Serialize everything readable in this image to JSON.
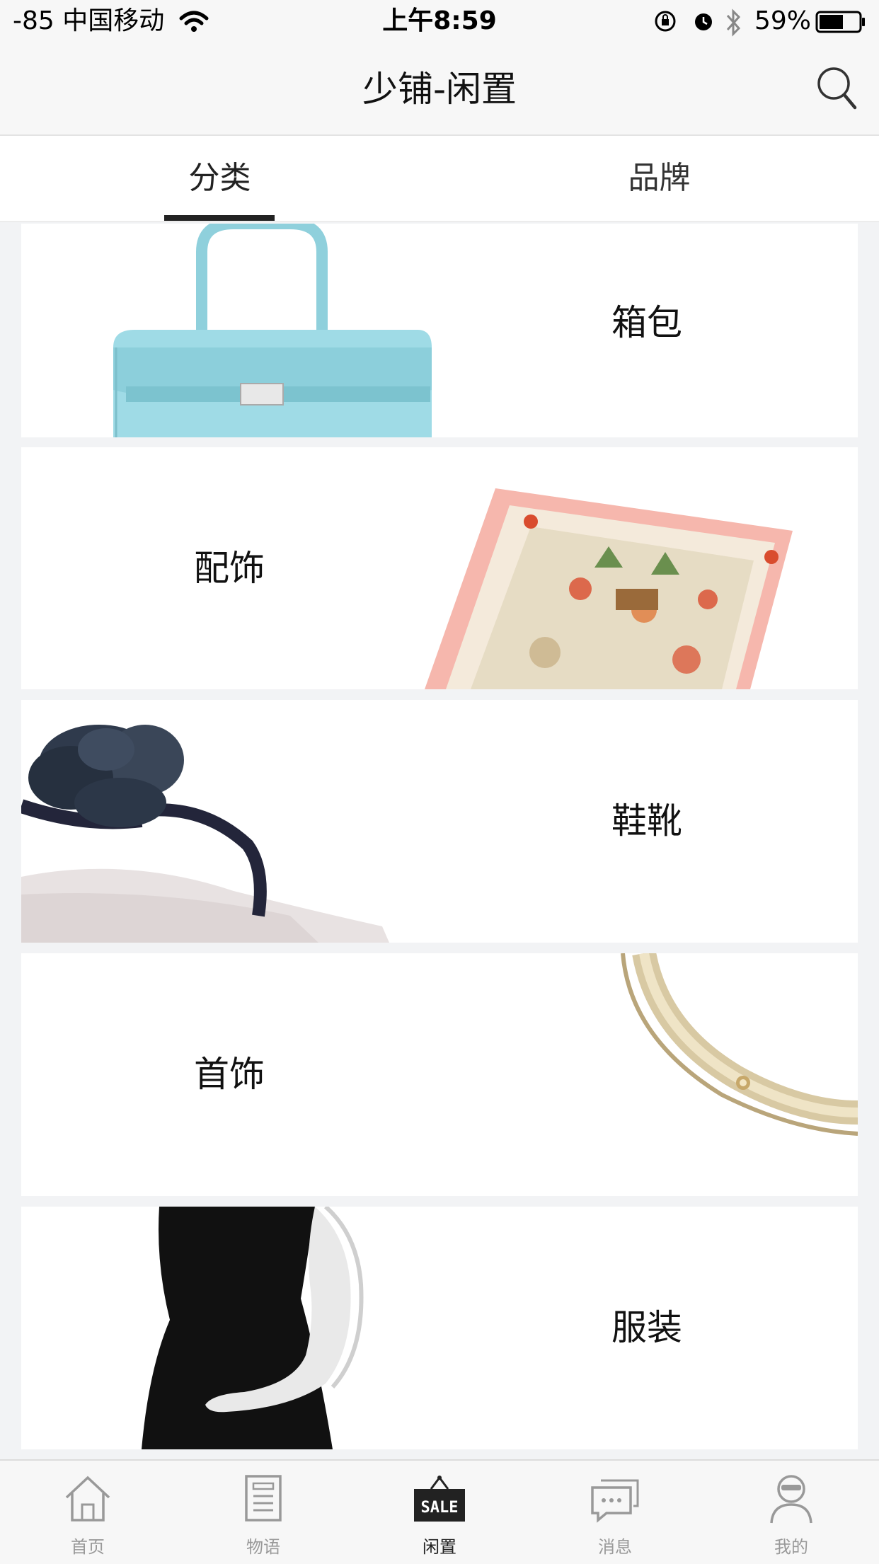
{
  "status_bar": {
    "carrier": "-85 中国移动",
    "time": "上午8:59",
    "battery": "59%"
  },
  "nav": {
    "title": "少铺-闲置"
  },
  "tabs": [
    {
      "label": "分类",
      "active": true
    },
    {
      "label": "品牌",
      "active": false
    }
  ],
  "categories": [
    {
      "label": "箱包",
      "image": "handbag"
    },
    {
      "label": "配饰",
      "image": "silk-scarf"
    },
    {
      "label": "鞋靴",
      "image": "sandal"
    },
    {
      "label": "首饰",
      "image": "ring"
    },
    {
      "label": "服装",
      "image": "dress"
    }
  ],
  "bottom_tabs": [
    {
      "label": "首页",
      "icon": "home-icon"
    },
    {
      "label": "物语",
      "icon": "document-icon"
    },
    {
      "label": "闲置",
      "icon": "sale-icon",
      "active": true,
      "badge_text": "SALE"
    },
    {
      "label": "消息",
      "icon": "message-icon"
    },
    {
      "label": "我的",
      "icon": "profile-icon"
    }
  ],
  "colors": {
    "background": "#f2f3f5",
    "accent": "#222222",
    "inactive_tab": "#999999"
  }
}
